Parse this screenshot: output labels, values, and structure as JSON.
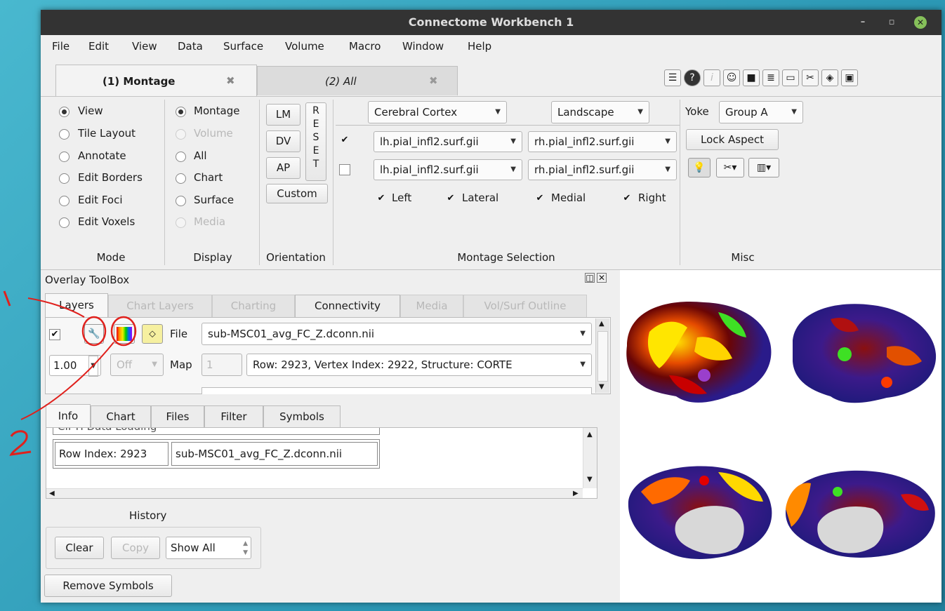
{
  "window": {
    "title": "Connectome Workbench 1",
    "minimize_glyph": "–",
    "restore_glyph": "▫",
    "close_glyph": "✕"
  },
  "menu": [
    "File",
    "Edit",
    "View",
    "Data",
    "Surface",
    "Volume",
    "Macro",
    "Window",
    "Help"
  ],
  "browser_tabs": [
    {
      "label": "(1) Montage",
      "close": "✖"
    },
    {
      "label": "(2) All",
      "close": "✖"
    }
  ],
  "toolbar_icons": [
    "info-panel-icon",
    "help-icon",
    "identify-icon",
    "head-icon",
    "movie-icon",
    "scene-icon",
    "clapper-icon",
    "tools-icon",
    "layers-icon",
    "toolbox-icon"
  ],
  "mode": {
    "items": [
      {
        "label": "View",
        "selected": true
      },
      {
        "label": "Tile Layout"
      },
      {
        "label": "Annotate"
      },
      {
        "label": "Edit Borders"
      },
      {
        "label": "Edit Foci"
      },
      {
        "label": "Edit Voxels"
      }
    ],
    "title": "Mode"
  },
  "display": {
    "items": [
      {
        "label": "Montage",
        "selected": true
      },
      {
        "label": "Volume",
        "disabled": true
      },
      {
        "label": "All"
      },
      {
        "label": "Chart"
      },
      {
        "label": "Surface"
      },
      {
        "label": "Media",
        "disabled": true
      }
    ],
    "title": "Display"
  },
  "orientation": {
    "lm": "LM",
    "dv": "DV",
    "ap": "AP",
    "custom": "Custom",
    "reset_letters": [
      "R",
      "E",
      "S",
      "E",
      "T"
    ],
    "title": "Orientation"
  },
  "montage": {
    "structure": "Cerebral Cortex",
    "layout": "Landscape",
    "row1_checked": "✔",
    "lh1": "lh.pial_infl2.surf.gii",
    "rh1": "rh.pial_infl2.surf.gii",
    "lh2": "lh.pial_infl2.surf.gii",
    "rh2": "rh.pial_infl2.surf.gii",
    "left": "Left",
    "lateral": "Lateral",
    "medial": "Medial",
    "right": "Right",
    "check": "✔",
    "title": "Montage Selection"
  },
  "misc": {
    "yoke": "Yoke",
    "group": "Group A",
    "lock_aspect": "Lock Aspect",
    "title": "Misc"
  },
  "overlay": {
    "title": "Overlay ToolBox",
    "tabs": [
      "Layers",
      "Chart Layers",
      "Charting",
      "Connectivity",
      "Media",
      "Vol/Surf Outline"
    ],
    "file_label": "File",
    "file": "sub-MSC01_avg_FC_Z.dconn.nii",
    "opacity": "1.00",
    "off": "Off",
    "map_label": "Map",
    "map_index": "1",
    "map": "Row: 2923, Vertex Index: 2922, Structure: CORTE"
  },
  "info": {
    "tabs": [
      "Info",
      "Chart",
      "Files",
      "Filter",
      "Symbols"
    ],
    "cut_text": "CIFTI Data Loading",
    "row_index": "Row Index: 2923",
    "row_file": "sub-MSC01_avg_FC_Z.dconn.nii",
    "history": "History",
    "clear": "Clear",
    "copy": "Copy",
    "show_all": "Show All",
    "remove_symbols": "Remove Symbols"
  },
  "annotations": {
    "one": "1",
    "two": "2"
  },
  "colors": {
    "titlebar": "#333333",
    "panel": "#efefef",
    "annotation": "#e0201c",
    "close_button": "#86c05a"
  }
}
